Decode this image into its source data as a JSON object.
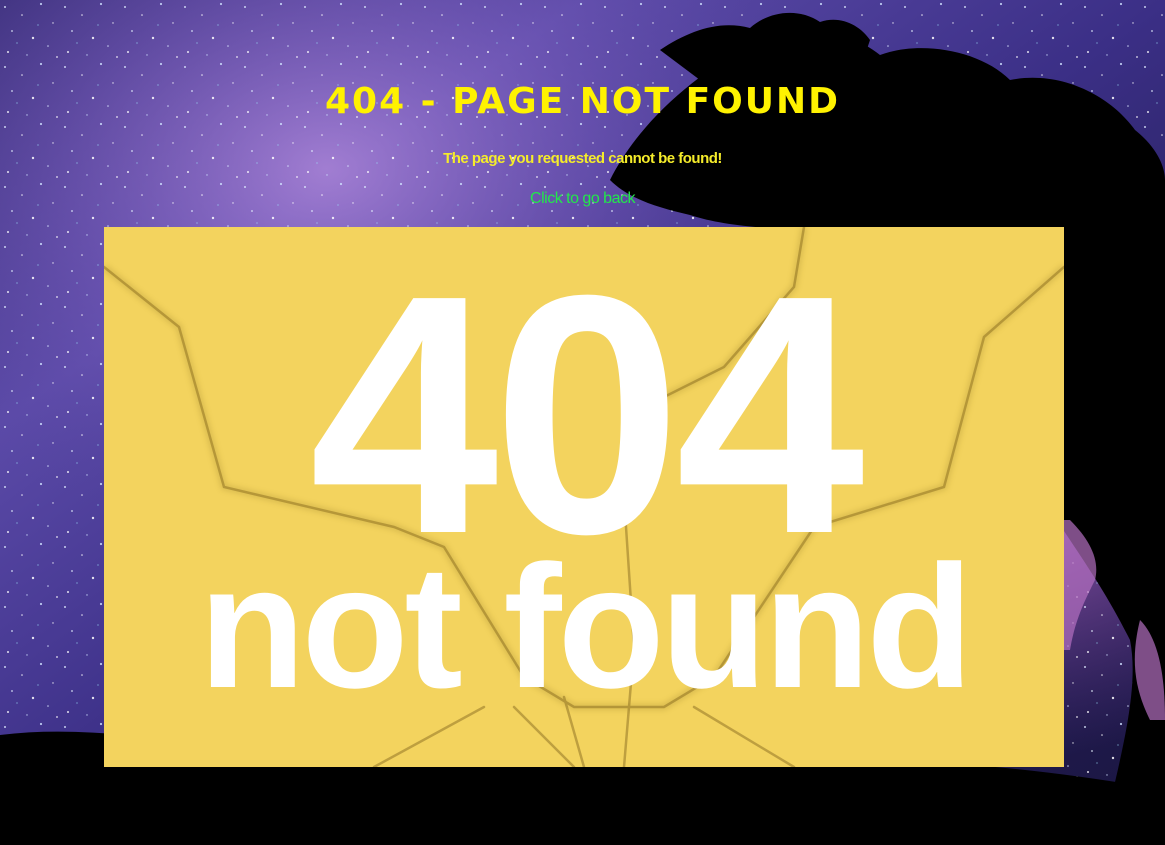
{
  "page": {
    "title": "404 - PAGE NOT FOUND",
    "subtitle": "The page you requested cannot be found!",
    "back_link": "Click to go back"
  },
  "banner": {
    "code": "404",
    "caption": "not found",
    "background_color": "#f3d35e"
  },
  "colors": {
    "title": "#fff200",
    "subtitle": "#f5ec2a",
    "link": "#22e84a",
    "page_background": "#000000"
  },
  "icons": {
    "background": "starry-night-sky",
    "tree": "tree-silhouette"
  }
}
